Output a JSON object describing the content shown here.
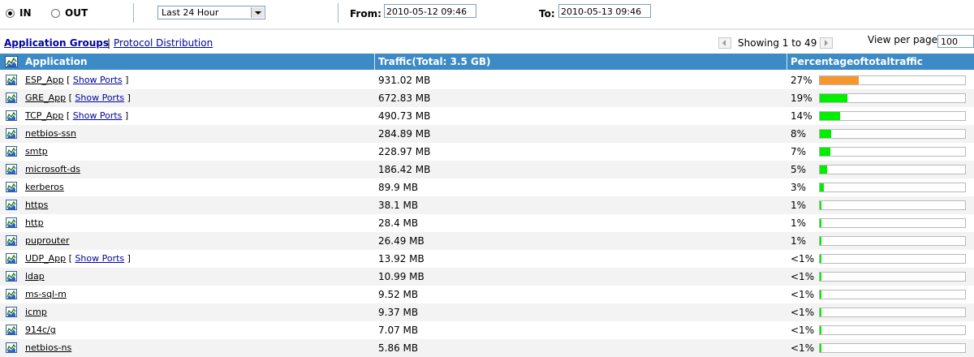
{
  "filter": {
    "direction_in": "IN",
    "direction_out": "OUT",
    "direction_selected": "IN",
    "period": "Last 24 Hour",
    "from_label": "From:",
    "from_value": "2010-05-12 09:46",
    "to_label": "To:",
    "to_value": "2010-05-13 09:46"
  },
  "nav": {
    "application_groups": "Application Groups",
    "separator": "|",
    "protocol_distribution": "Protocol Distribution",
    "showing": "Showing 1 to 49",
    "view_per_page_label": "View per page",
    "view_per_page_value": "100"
  },
  "table": {
    "columns": [
      "Application",
      "Traffic(Total: 3.5 GB)",
      "Percentageoftotaltraffic"
    ],
    "show_ports_label": "Show Ports",
    "rows": [
      {
        "app": "ESP_App",
        "ports": true,
        "traffic": "931.02 MB",
        "pct": "27%",
        "fraction": 0.27,
        "color": "#f7962e"
      },
      {
        "app": "GRE_App",
        "ports": true,
        "traffic": "672.83 MB",
        "pct": "19%",
        "fraction": 0.19,
        "color": "#00ee00"
      },
      {
        "app": "TCP_App",
        "ports": true,
        "traffic": "490.73 MB",
        "pct": "14%",
        "fraction": 0.14,
        "color": "#00ee00"
      },
      {
        "app": "netbios-ssn",
        "ports": false,
        "traffic": "284.89 MB",
        "pct": "8%",
        "fraction": 0.08,
        "color": "#00ee00"
      },
      {
        "app": "smtp",
        "ports": false,
        "traffic": "228.97 MB",
        "pct": "7%",
        "fraction": 0.07,
        "color": "#00ee00"
      },
      {
        "app": "microsoft-ds",
        "ports": false,
        "traffic": "186.42 MB",
        "pct": "5%",
        "fraction": 0.05,
        "color": "#00ee00"
      },
      {
        "app": "kerberos",
        "ports": false,
        "traffic": "89.9 MB",
        "pct": "3%",
        "fraction": 0.03,
        "color": "#00ee00"
      },
      {
        "app": "https",
        "ports": false,
        "traffic": "38.1 MB",
        "pct": "1%",
        "fraction": 0.01,
        "color": "#00ee00"
      },
      {
        "app": "http",
        "ports": false,
        "traffic": "28.4 MB",
        "pct": "1%",
        "fraction": 0.01,
        "color": "#00ee00"
      },
      {
        "app": "puprouter",
        "ports": false,
        "traffic": "26.49 MB",
        "pct": "1%",
        "fraction": 0.01,
        "color": "#00ee00"
      },
      {
        "app": "UDP_App",
        "ports": true,
        "traffic": "13.92 MB",
        "pct": "<1%",
        "fraction": 0.005,
        "color": "#00ee00"
      },
      {
        "app": "ldap",
        "ports": false,
        "traffic": "10.99 MB",
        "pct": "<1%",
        "fraction": 0.005,
        "color": "#00ee00"
      },
      {
        "app": "ms-sql-m",
        "ports": false,
        "traffic": "9.52 MB",
        "pct": "<1%",
        "fraction": 0.005,
        "color": "#00ee00"
      },
      {
        "app": "icmp",
        "ports": false,
        "traffic": "9.37 MB",
        "pct": "<1%",
        "fraction": 0.005,
        "color": "#00ee00"
      },
      {
        "app": "914c/g",
        "ports": false,
        "traffic": "7.07 MB",
        "pct": "<1%",
        "fraction": 0.005,
        "color": "#00ee00"
      },
      {
        "app": "netbios-ns",
        "ports": false,
        "traffic": "5.86 MB",
        "pct": "<1%",
        "fraction": 0.005,
        "color": "#00ee00"
      }
    ]
  },
  "colors": {
    "header_bg": "#3c8ac6",
    "link": "#00049b",
    "bar_top": "#f7962e",
    "bar_normal": "#00ee00"
  },
  "icons": {
    "row_icon": "chart-icon",
    "header_icon": "chart-icon"
  }
}
